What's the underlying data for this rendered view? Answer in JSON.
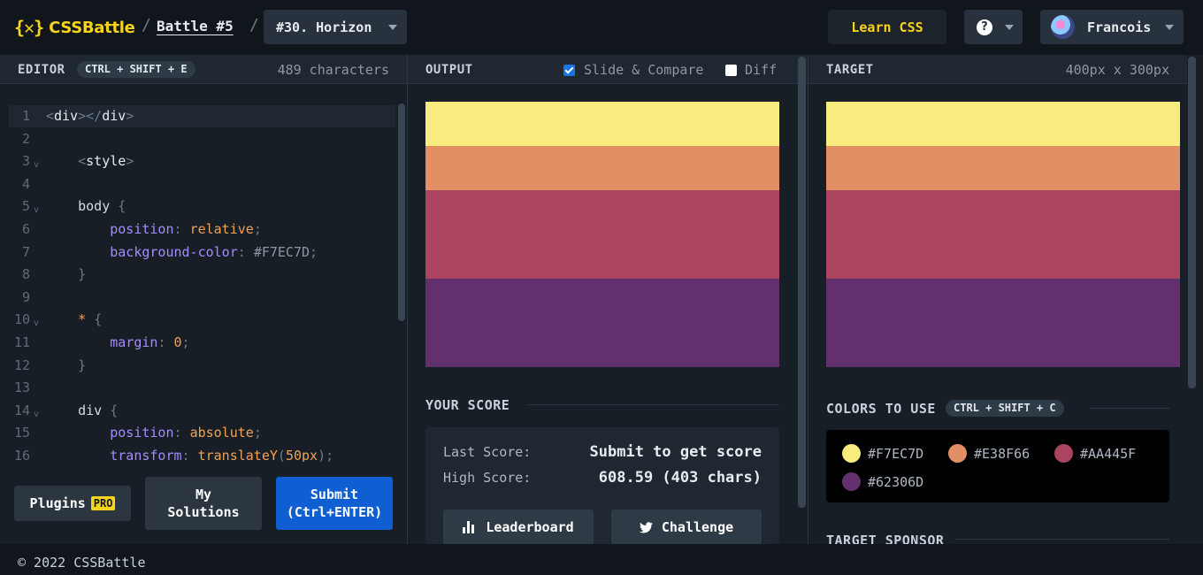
{
  "header": {
    "logo_mark": "{✕}",
    "logo_text": "CSSBattle",
    "separator": "/",
    "battle": "Battle #5",
    "level": "#30. Horizon",
    "learn": "Learn CSS",
    "help_icon": "?",
    "user": "Francois"
  },
  "editor": {
    "title": "EDITOR",
    "shortcut": "CTRL + SHIFT + E",
    "char_count": "489 characters",
    "lines": [
      {
        "n": "1",
        "fold": false,
        "parts": [
          [
            "t-punc",
            "<"
          ],
          [
            "t-tag",
            "div"
          ],
          [
            "t-punc",
            "></"
          ],
          [
            "t-tag",
            "div"
          ],
          [
            "t-punc",
            ">"
          ]
        ]
      },
      {
        "n": "2",
        "fold": false,
        "parts": []
      },
      {
        "n": "3",
        "fold": true,
        "parts": [
          [
            "t-plain",
            "    "
          ],
          [
            "t-punc",
            "<"
          ],
          [
            "t-tag",
            "style"
          ],
          [
            "t-punc",
            ">"
          ]
        ]
      },
      {
        "n": "4",
        "fold": false,
        "parts": []
      },
      {
        "n": "5",
        "fold": true,
        "parts": [
          [
            "t-plain",
            "    body "
          ],
          [
            "t-punc",
            "{"
          ]
        ]
      },
      {
        "n": "6",
        "fold": false,
        "parts": [
          [
            "t-plain",
            "        "
          ],
          [
            "t-prop",
            "position"
          ],
          [
            "t-punc",
            ": "
          ],
          [
            "t-val",
            "relative"
          ],
          [
            "t-punc",
            ";"
          ]
        ]
      },
      {
        "n": "7",
        "fold": false,
        "parts": [
          [
            "t-plain",
            "        "
          ],
          [
            "t-prop",
            "background-color"
          ],
          [
            "t-punc",
            ": "
          ],
          [
            "t-hex",
            "#F7EC7D"
          ],
          [
            "t-punc",
            ";"
          ]
        ]
      },
      {
        "n": "8",
        "fold": false,
        "parts": [
          [
            "t-plain",
            "    "
          ],
          [
            "t-punc",
            "}"
          ]
        ]
      },
      {
        "n": "9",
        "fold": false,
        "parts": []
      },
      {
        "n": "10",
        "fold": true,
        "parts": [
          [
            "t-plain",
            "    "
          ],
          [
            "t-sel",
            "*"
          ],
          [
            "t-plain",
            " "
          ],
          [
            "t-punc",
            "{"
          ]
        ]
      },
      {
        "n": "11",
        "fold": false,
        "parts": [
          [
            "t-plain",
            "        "
          ],
          [
            "t-prop",
            "margin"
          ],
          [
            "t-punc",
            ": "
          ],
          [
            "t-num",
            "0"
          ],
          [
            "t-punc",
            ";"
          ]
        ]
      },
      {
        "n": "12",
        "fold": false,
        "parts": [
          [
            "t-plain",
            "    "
          ],
          [
            "t-punc",
            "}"
          ]
        ]
      },
      {
        "n": "13",
        "fold": false,
        "parts": []
      },
      {
        "n": "14",
        "fold": true,
        "parts": [
          [
            "t-plain",
            "    div "
          ],
          [
            "t-punc",
            "{"
          ]
        ]
      },
      {
        "n": "15",
        "fold": false,
        "parts": [
          [
            "t-plain",
            "        "
          ],
          [
            "t-prop",
            "position"
          ],
          [
            "t-punc",
            ": "
          ],
          [
            "t-val",
            "absolute"
          ],
          [
            "t-punc",
            ";"
          ]
        ]
      },
      {
        "n": "16",
        "fold": false,
        "parts": [
          [
            "t-plain",
            "        "
          ],
          [
            "t-prop",
            "transform"
          ],
          [
            "t-punc",
            ": "
          ],
          [
            "t-val",
            "translateY"
          ],
          [
            "t-punc",
            "("
          ],
          [
            "t-num",
            "50"
          ],
          [
            "t-val",
            "px"
          ],
          [
            "t-punc",
            ");"
          ]
        ]
      }
    ],
    "plugins": "Plugins",
    "pro": "PRO",
    "my_solutions": "My\nSolutions",
    "submit": "Submit\n(Ctrl+ENTER)"
  },
  "output": {
    "title": "OUTPUT",
    "slide_compare": "Slide & Compare",
    "slide_compare_checked": true,
    "diff": "Diff",
    "diff_checked": false
  },
  "score": {
    "title": "YOUR SCORE",
    "last_label": "Last Score:",
    "last_value": "Submit to get score",
    "high_label": "High Score:",
    "high_value": "608.59 (403 chars)",
    "leaderboard": "Leaderboard",
    "challenge": "Challenge"
  },
  "target": {
    "title": "TARGET",
    "size": "400px x 300px",
    "colors_title": "COLORS TO USE",
    "colors_shortcut": "CTRL + SHIFT + C",
    "sponsor_title": "TARGET SPONSOR",
    "colors": [
      "#F7EC7D",
      "#E38F66",
      "#AA445F",
      "#62306D"
    ]
  },
  "footer": {
    "copyright": "© 2022 CSSBattle"
  }
}
